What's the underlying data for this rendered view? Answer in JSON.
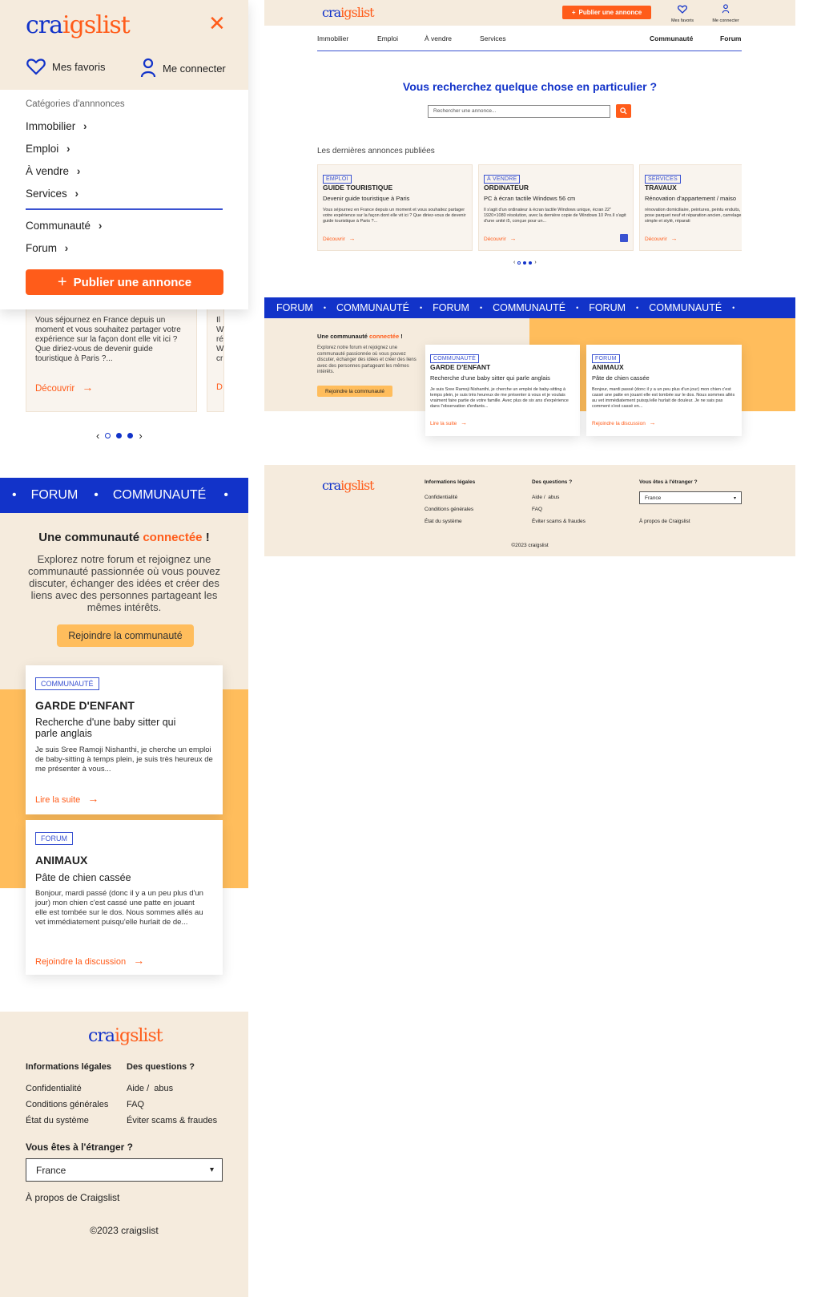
{
  "brand": {
    "logo_a": "cra",
    "logo_b": "igslist",
    "logo_full": "craigslist"
  },
  "colors": {
    "accent": "#ff5c1a",
    "primary": "#1233c9",
    "cream": "#f5ebdd",
    "yellow": "#ffbd5c"
  },
  "mobile_menu": {
    "favorites": "Mes favoris",
    "login": "Me connecter",
    "categories_heading": "Catégories d'annnonces",
    "items": [
      "Immobilier",
      "Emploi",
      "À vendre",
      "Services"
    ],
    "items2": [
      "Communauté",
      "Forum"
    ],
    "publish": "Publier une annonce"
  },
  "mobile_card": {
    "text": "Vous séjournez en France depuis un moment et vous souhaitez partager votre expérience sur la façon dont elle vit ici ? Que diriez-vous de devenir guide touristique à Paris ?...",
    "partial_a": "Il",
    "partial_b": "W",
    "partial_c": "ré",
    "partial_d": "W",
    "partial_e": "cr",
    "cta": "Découvrir",
    "cta_partial": "D"
  },
  "desktop": {
    "publish": "Publier une annonce",
    "favorites": "Mes favoris",
    "login": "Me connecter",
    "nav": [
      "Immobilier",
      "Emploi",
      "À vendre",
      "Services"
    ],
    "nav_right": [
      "Communauté",
      "Forum"
    ],
    "search_title": "Vous recherchez quelque chose en particulier ?",
    "search_placeholder": "Rechercher une annonce...",
    "latest_heading": "Les dernières annonces publiées",
    "cards": [
      {
        "tag": "EMPLOI",
        "title": "GUIDE TOURISTIQUE",
        "subtitle": "Devenir guide touristique à Paris",
        "text": "Vous séjournez en France depuis un moment et vous souhaitez partager votre expérience sur la façon dont elle vit ici ? Que diriez-vous de devenir guide touristique à Paris ?...",
        "cta": "Découvrir"
      },
      {
        "tag": "À VENDRE",
        "title": "ORDINATEUR",
        "subtitle": "PC à écran tactile Windows 56 cm",
        "text": "Il s'agit d'un ordinateur à écran tactile Windows unique, écran 22\" 1920×1080 résolution, avec la dernière copie de Windows 10 Pro.Il s'agit d'une unité i5, conçue pour un...",
        "cta": "Découvrir"
      },
      {
        "tag": "SERVICES",
        "title": "TRAVAUX",
        "subtitle": "Rénovation d'appartement / maiso",
        "text": "rénovation domiciliaire, peintures, peintu enduits, pose parquet neuf et réparation ancien, carrelage simple et stylé, réparati",
        "cta": "Découvrir"
      }
    ],
    "banner": [
      "FORUM",
      "COMMUNAUTÉ",
      "FORUM",
      "COMMUNAUTÉ",
      "FORUM",
      "COMMUNAUTÉ"
    ],
    "community_title_a": "Une communauté ",
    "community_title_b": "connectée",
    "community_title_c": " !",
    "community_text": "Explorez notre forum et rejoignez une communauté passionnée où vous pouvez discuter, échanger des idées et créer des liens avec des personnes partageant les mêmes intérêts.",
    "community_button": "Rejoindre la communauté",
    "community_cards": [
      {
        "tag": "COMMUNAUTÉ",
        "title": "GARDE D'ENFANT",
        "subtitle": "Recherche d'une baby sitter qui parle anglais",
        "text": "Je suis Sree Ramoji Nishanthi, je cherche un emploi de baby-sitting à temps plein, je suis très heureux de me présenter à vous et je voulais vraiment faire partie de votre famille. Avec plus de six ans d'expérience dans l'observation d'enfants...",
        "cta": "Lire la suite"
      },
      {
        "tag": "FORUM",
        "title": "ANIMAUX",
        "subtitle": "Pâte de chien cassée",
        "text": "Bonjour, mardi passé (donc il y a un peu plus d'un jour) mon chien c'est cassé une patte en jouant elle est tombée sur le dos. Nous sommes allés au vet immédiatement puisqu'elle hurlait de douleur. Je ne sais pas comment s'est cassé en...",
        "cta": "Rejoindre la discussion"
      }
    ],
    "footer": {
      "col1_title": "Informations légales",
      "col1": [
        "Confidentialité",
        "Conditions générales",
        "État du système"
      ],
      "col2_title": "Des questions ?",
      "col2": [
        "Aide /  abus",
        "FAQ",
        "Éviter scams & fraudes"
      ],
      "col3_title": "Vous êtes à l'étranger ?",
      "country": "France",
      "about": "À propos de Craigslist",
      "copyright": "©2023 craigslist"
    }
  },
  "mobile_community": {
    "banner": [
      "FORUM",
      "COMMUNAUTÉ"
    ],
    "title_a": "Une communauté ",
    "title_b": "connectée",
    "title_c": " !",
    "text": "Explorez notre forum et rejoignez une communauté passionnée où vous pouvez discuter, échanger des idées et créer des liens avec des personnes partageant les mêmes intérêts.",
    "button": "Rejoindre la communauté",
    "cards": [
      {
        "tag": "COMMUNAUTÉ",
        "title": "GARDE D'ENFANT",
        "subtitle": "Recherche d'une baby sitter qui parle anglais",
        "text": "Je suis Sree Ramoji Nishanthi, je cherche un emploi de baby-sitting à temps plein, je suis très heureux de me présenter à vous...",
        "cta": "Lire la suite"
      },
      {
        "tag": "FORUM",
        "title": "ANIMAUX",
        "subtitle": "Pâte de chien cassée",
        "text": "Bonjour, mardi passé (donc il y a un peu plus d'un jour) mon chien c'est cassé une patte en jouant elle est tombée sur le dos. Nous sommes allés au vet immédiatement puisqu'elle hurlait de de...",
        "cta": "Rejoindre la discussion"
      }
    ]
  },
  "mobile_footer": {
    "col1_title": "Informations légales",
    "col1": [
      "Confidentialité",
      "Conditions générales",
      "État du système"
    ],
    "col2_title": "Des questions ?",
    "col2": [
      "Aide /  abus",
      "FAQ",
      "Éviter scams & fraudes"
    ],
    "abroad": "Vous êtes à l'étranger ?",
    "country": "France",
    "about": "À propos de Craigslist",
    "copyright": "©2023 craigslist"
  }
}
